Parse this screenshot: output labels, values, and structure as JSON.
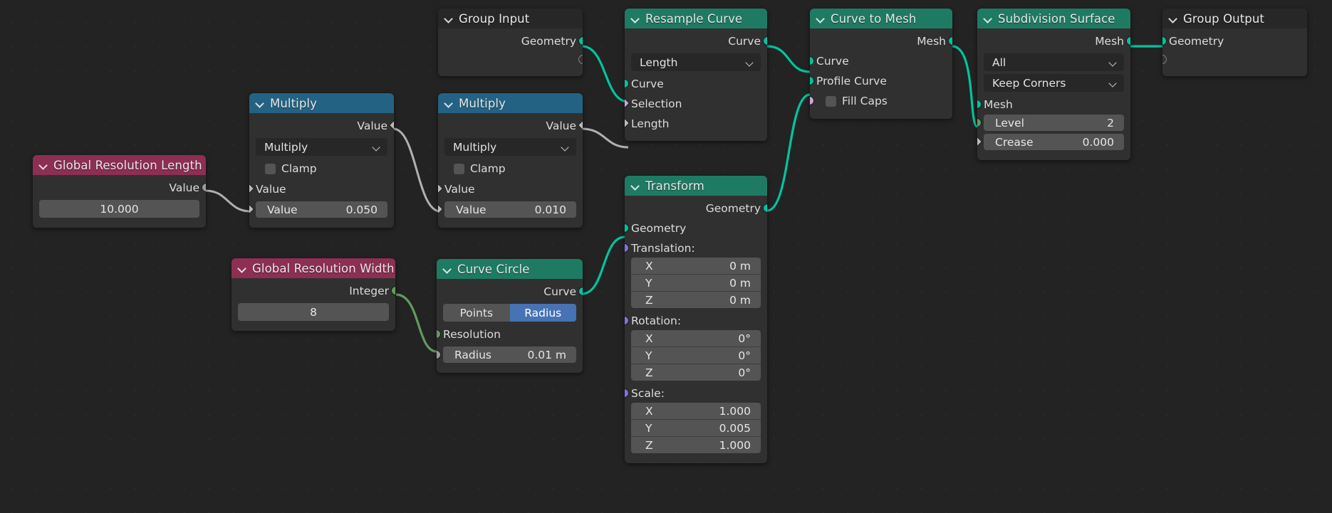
{
  "editor": {
    "name": "blender-geometry-node-editor",
    "background": "#232323"
  },
  "colors": {
    "header_geometry": "#1f7a63",
    "header_math": "#246283",
    "header_input": "#8c2f52",
    "header_group": "#272727",
    "node_body": "#303030",
    "socket_geometry": "#00c49e",
    "socket_value": "#9a9a9a",
    "socket_int": "#629a60",
    "socket_vector": "#7c74de",
    "socket_boolean": "#d4a0d8",
    "toggle_active": "#4772b3",
    "wire_geometry": "#00c49e",
    "wire_value": "#b0b0b0",
    "wire_int": "#629a60"
  },
  "nodes": {
    "global_resolution_length": {
      "title": "Global Resolution Length",
      "output_label": "Value",
      "value": "10.000"
    },
    "global_resolution_width": {
      "title": "Global Resolution Width",
      "output_label": "Integer",
      "value": "8"
    },
    "multiply_a": {
      "title": "Multiply",
      "output_label": "Value",
      "operation": "Multiply",
      "clamp_label": "Clamp",
      "input_label": "Value",
      "field_label": "Value",
      "field_value": "0.050"
    },
    "multiply_b": {
      "title": "Multiply",
      "output_label": "Value",
      "operation": "Multiply",
      "clamp_label": "Clamp",
      "input_label": "Value",
      "field_label": "Value",
      "field_value": "0.010"
    },
    "curve_circle": {
      "title": "Curve Circle",
      "output_label": "Curve",
      "mode_points": "Points",
      "mode_radius": "Radius",
      "resolution_label": "Resolution",
      "radius_label": "Radius",
      "radius_value": "0.01 m"
    },
    "group_input": {
      "title": "Group Input",
      "output_label": "Geometry"
    },
    "resample_curve": {
      "title": "Resample Curve",
      "output_label": "Curve",
      "mode": "Length",
      "input_curve": "Curve",
      "input_selection": "Selection",
      "input_length": "Length"
    },
    "transform": {
      "title": "Transform",
      "output_label": "Geometry",
      "input_geometry": "Geometry",
      "translation_label": "Translation:",
      "translation": {
        "x_axis": "X",
        "y_axis": "Y",
        "z_axis": "Z",
        "x": "0 m",
        "y": "0 m",
        "z": "0 m"
      },
      "rotation_label": "Rotation:",
      "rotation": {
        "x_axis": "X",
        "y_axis": "Y",
        "z_axis": "Z",
        "x": "0°",
        "y": "0°",
        "z": "0°"
      },
      "scale_label": "Scale:",
      "scale": {
        "x_axis": "X",
        "y_axis": "Y",
        "z_axis": "Z",
        "x": "1.000",
        "y": "0.005",
        "z": "1.000"
      }
    },
    "curve_to_mesh": {
      "title": "Curve to Mesh",
      "output_label": "Mesh",
      "input_curve": "Curve",
      "input_profile_curve": "Profile Curve",
      "input_fill_caps": "Fill Caps"
    },
    "subdivision_surface": {
      "title": "Subdivision Surface",
      "output_label": "Mesh",
      "uv_smooth": "All",
      "boundary_smooth": "Keep Corners",
      "input_mesh": "Mesh",
      "level_label": "Level",
      "level_value": "2",
      "crease_label": "Crease",
      "crease_value": "0.000"
    },
    "group_output": {
      "title": "Group Output",
      "input_label": "Geometry"
    }
  }
}
